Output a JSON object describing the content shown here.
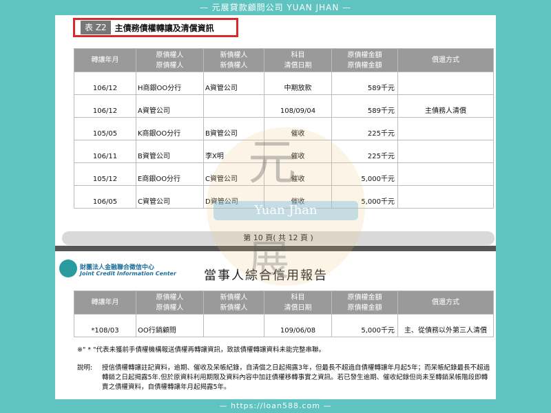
{
  "header_text": "— 元展貸款顧問公司 YUAN JHAN —",
  "footer_text": "— https://loan588.com —",
  "table1": {
    "tag": "表 Z2",
    "caption": "主債務債權轉讓及清償資訊",
    "headers": {
      "c1": "轉讓年月",
      "c2a": "原債權人",
      "c2b": "原債權人",
      "c3a": "新債權人",
      "c3b": "新債權人",
      "c4a": "科目",
      "c4b": "清償日期",
      "c5a": "原債權金額",
      "c5b": "原債權金額",
      "c6": "償還方式"
    },
    "rows": [
      {
        "ym": "106/12",
        "orig": "H商銀OO分行",
        "new": "A資管公司",
        "item": "中期放款",
        "amount": "589千元",
        "method": ""
      },
      {
        "ym": "106/12",
        "orig": "A資管公司",
        "new": "",
        "item": "108/09/04",
        "amount": "589千元",
        "method": "主債務人清償"
      },
      {
        "ym": "105/05",
        "orig": "K商銀OO分行",
        "new": "B資管公司",
        "item": "催收",
        "amount": "225千元",
        "method": ""
      },
      {
        "ym": "106/11",
        "orig": "B資管公司",
        "new": "李X明",
        "item": "催收",
        "amount": "225千元",
        "method": ""
      },
      {
        "ym": "105/12",
        "orig": "E商銀OO分行",
        "new": "C資管公司",
        "item": "催收",
        "amount": "5,000千元",
        "method": ""
      },
      {
        "ym": "106/05",
        "orig": "C資管公司",
        "new": "D資管公司",
        "item": "催收",
        "amount": "5,000千元",
        "method": ""
      }
    ],
    "page_number": "第 10 頁( 共 12 頁 )"
  },
  "report": {
    "org_zh": "財團法人金融聯合徵信中心",
    "org_en": "Joint Credit Information Center",
    "title": "當事人綜合信用報告"
  },
  "table2": {
    "headers": {
      "c1": "轉讓年月",
      "c2a": "原債權人",
      "c2b": "原債權人",
      "c3a": "新債權人",
      "c3b": "新債權人",
      "c4a": "科目",
      "c4b": "清償日期",
      "c5a": "原債權金額",
      "c5b": "原債權金額",
      "c6": "償還方式"
    },
    "rows": [
      {
        "ym": "*108/03",
        "orig": "OO行銷顧問",
        "new": "",
        "item": "109/06/08",
        "amount": "5,000千元",
        "method": "主、從債務以外第三人清償"
      }
    ]
  },
  "note_star": "※\" * \"代表未獲前手債權機構報送債權再轉讓資訊，致該債權轉讓資料未能完整串聯。",
  "note_label": "說明:",
  "note_body": "授信債權轉讓註記資料，逾期、催收及呆帳紀錄，自清償之日起揭露3年，但最長不超過自債權轉讓年月起5年；而呆帳紀錄最長不超過轉銷之日起揭露5年.但於原資料利用期限及資料內容中加註債權移轉事實之資訊。若已發生逾期、催收紀錄但尚未至轉銷呆帳階段即轉賣之債權資料，自債權轉讓年月起揭露5年。",
  "watermark": {
    "char_top": "元",
    "char_bottom": "展",
    "band_text": "Yuan Jhan"
  }
}
